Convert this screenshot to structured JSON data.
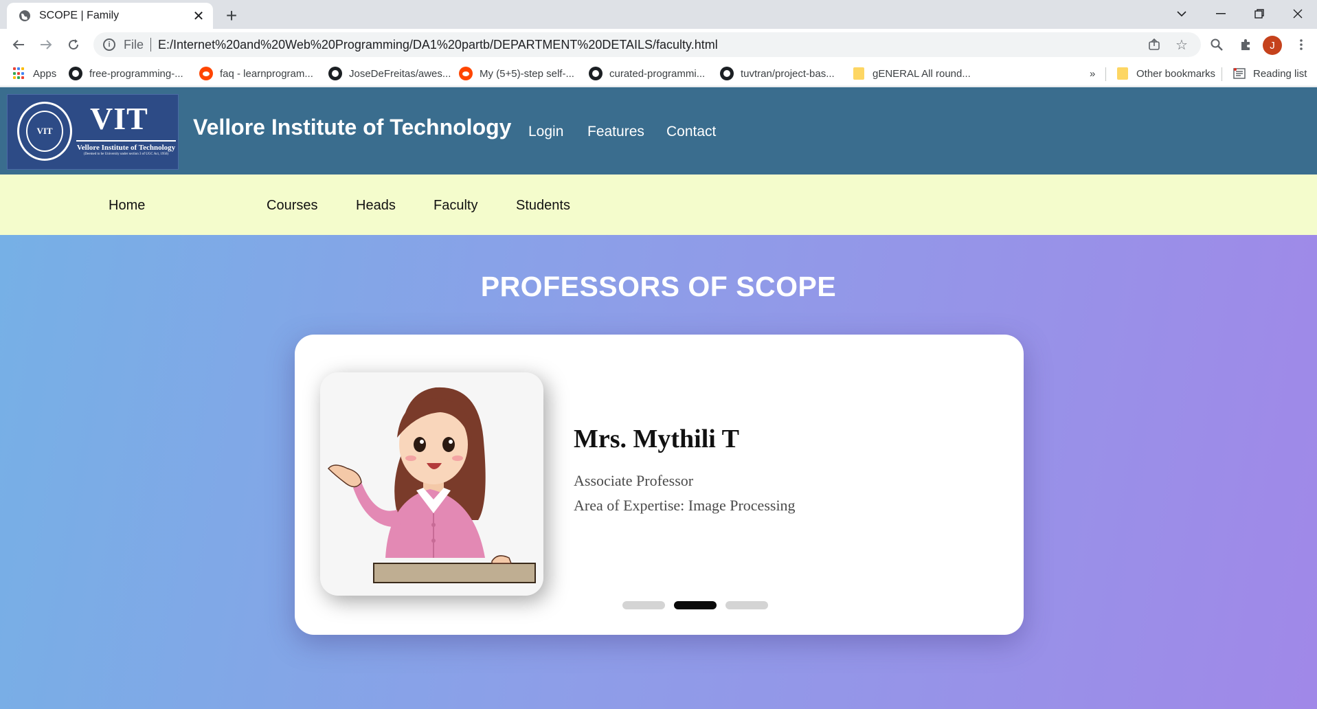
{
  "browser": {
    "tab_title": "SCOPE | Family",
    "address": {
      "scheme_label": "File",
      "url": "E:/Internet%20and%20Web%20Programming/DA1%20partb/DEPARTMENT%20DETAILS/faculty.html"
    },
    "profile_initial": "J",
    "bookmarks": [
      {
        "label": "Apps",
        "icon": "apps-grid-icon"
      },
      {
        "label": "free-programming-...",
        "icon": "github-icon"
      },
      {
        "label": "faq - learnprogram...",
        "icon": "reddit-icon"
      },
      {
        "label": "JoseDeFreitas/awes...",
        "icon": "github-icon"
      },
      {
        "label": "My (5+5)-step self-...",
        "icon": "reddit-icon"
      },
      {
        "label": "curated-programmi...",
        "icon": "github-icon"
      },
      {
        "label": "tuvtran/project-bas...",
        "icon": "github-icon"
      },
      {
        "label": "gENERAL All round...",
        "icon": "folder-icon"
      }
    ],
    "overflow_label": "»",
    "other_bookmarks": "Other bookmarks",
    "reading_list": "Reading list"
  },
  "site": {
    "logo": {
      "seal_text": "VIT",
      "mark": "VIT",
      "name": "Vellore Institute of Technology",
      "tagline": "(Deemed to be University under section 3 of UGC Act, 1956)"
    },
    "title": "Vellore Institute of Technology",
    "header_nav": [
      "Login",
      "Features",
      "Contact"
    ],
    "subnav": [
      "Home",
      "Courses",
      "Heads",
      "Faculty",
      "Students"
    ],
    "section_title": "PROFESSORS OF SCOPE",
    "professor": {
      "name": "Mrs. Mythili T",
      "role": "Associate Professor",
      "expertise": "Area of Expertise: Image Processing"
    },
    "carousel": {
      "count": 3,
      "active_index": 1
    }
  },
  "colors": {
    "header_bg": "#3a6d8e",
    "subnav_bg": "#f4fccc",
    "hero_gradient_start": "#76b0e6",
    "hero_gradient_end": "#a088e8"
  }
}
